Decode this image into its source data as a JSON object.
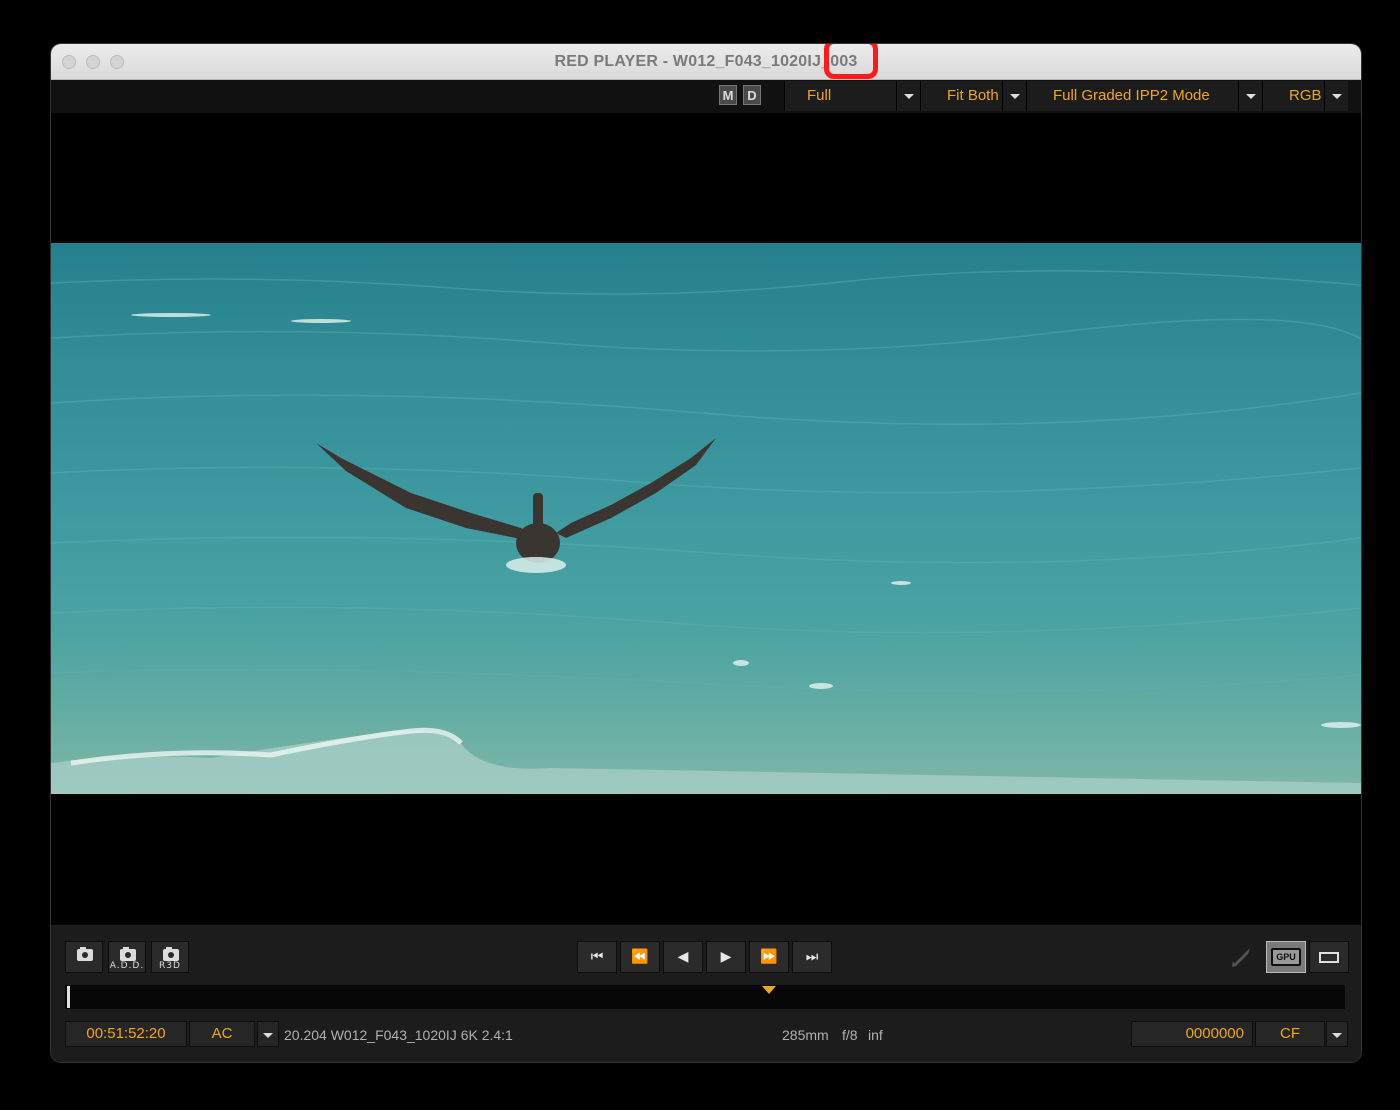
{
  "window": {
    "title": "RED PLAYER - W012_F043_1020IJ_003"
  },
  "toolbar": {
    "m_label": "M",
    "d_label": "D",
    "resolution": {
      "value": "Full"
    },
    "fit": {
      "value": "Fit Both"
    },
    "mode": {
      "value": "Full Graded IPP2 Mode"
    },
    "color": {
      "value": "RGB"
    }
  },
  "transport": {
    "snapshot_add_label": "A.D.D.",
    "snapshot_r3d_label": "R3D",
    "buttons": [
      "go-to-start",
      "step-back-fast",
      "step-back",
      "play",
      "step-forward-fast",
      "go-to-end"
    ],
    "gpu_label": "GPU"
  },
  "timeline": {
    "marker_fraction": 0.55
  },
  "status": {
    "timecode": "00:51:52:20",
    "timecode_mode": "AC",
    "clip_info": "20.204 W012_F043_1020IJ 6K 2.4:1",
    "lens_focal": "285mm",
    "lens_aperture": "f/8",
    "lens_focus": "inf",
    "frame_number": "0000000",
    "frame_mode": "CF"
  },
  "colors": {
    "accent": "#f0a51e",
    "highlight": "#ff1a1a"
  }
}
